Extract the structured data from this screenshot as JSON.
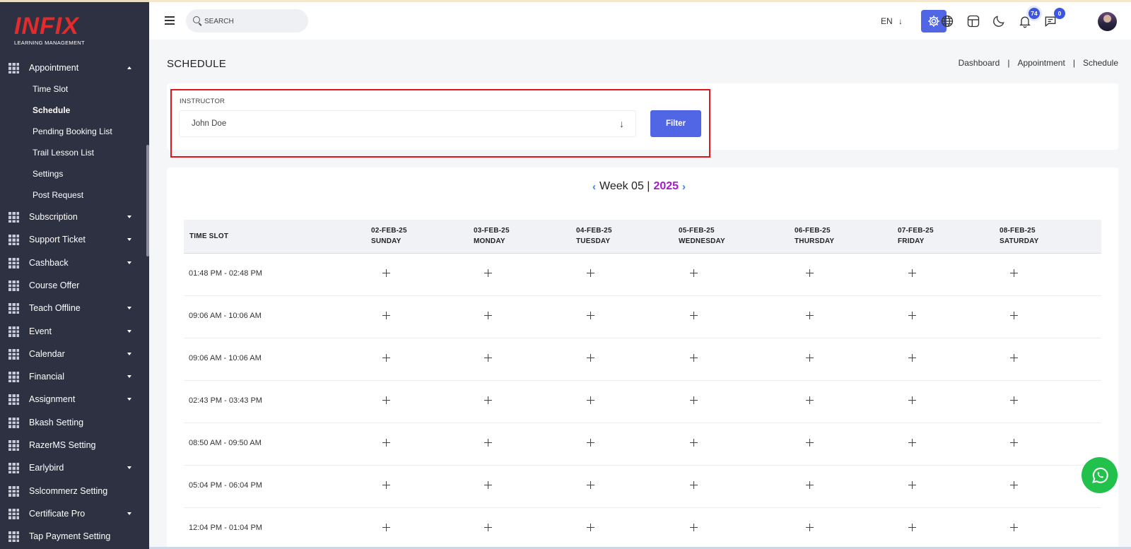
{
  "sidebar": {
    "logo_text": "INFIX",
    "logo_sub": "LEARNING MANAGEMENT",
    "appointment": {
      "label": "Appointment",
      "sub_items": [
        "Time Slot",
        "Schedule",
        "Pending Booking List",
        "Trail Lesson List",
        "Settings",
        "Post Request"
      ],
      "active": "Schedule"
    },
    "items": [
      {
        "label": "Subscription",
        "has_caret": true
      },
      {
        "label": "Support Ticket",
        "has_caret": true
      },
      {
        "label": "Cashback",
        "has_caret": true
      },
      {
        "label": "Course Offer",
        "has_caret": false
      },
      {
        "label": "Teach Offline",
        "has_caret": true
      },
      {
        "label": "Event",
        "has_caret": true
      },
      {
        "label": "Calendar",
        "has_caret": true
      },
      {
        "label": "Financial",
        "has_caret": true
      },
      {
        "label": "Assignment",
        "has_caret": true
      },
      {
        "label": "Bkash Setting",
        "has_caret": false
      },
      {
        "label": "RazerMS Setting",
        "has_caret": false
      },
      {
        "label": "Earlybird",
        "has_caret": true
      },
      {
        "label": "Sslcommerz Setting",
        "has_caret": false
      },
      {
        "label": "Certificate Pro",
        "has_caret": true
      },
      {
        "label": "Tap Payment Setting",
        "has_caret": false
      }
    ]
  },
  "topbar": {
    "search_placeholder": "SEARCH",
    "language": "EN",
    "notifications_count": "74",
    "messages_count": "0",
    "icons": [
      "menu-icon",
      "search-icon",
      "settings-gear-icon",
      "globe-icon",
      "layout-icon",
      "moon-icon",
      "bell-icon",
      "chat-icon"
    ]
  },
  "page": {
    "title": "SCHEDULE",
    "breadcrumb": [
      "Dashboard",
      "Appointment",
      "Schedule"
    ]
  },
  "filter": {
    "label": "INSTRUCTOR",
    "selected": "John Doe",
    "button": "Filter"
  },
  "schedule": {
    "week_label": "Week 05 |",
    "year": "2025",
    "time_slot_header": "TIME SLOT",
    "days": [
      {
        "date": "02-FEB-25",
        "day": "SUNDAY"
      },
      {
        "date": "03-FEB-25",
        "day": "MONDAY"
      },
      {
        "date": "04-FEB-25",
        "day": "TUESDAY"
      },
      {
        "date": "05-FEB-25",
        "day": "WEDNESDAY"
      },
      {
        "date": "06-FEB-25",
        "day": "THURSDAY"
      },
      {
        "date": "07-FEB-25",
        "day": "FRIDAY"
      },
      {
        "date": "08-FEB-25",
        "day": "SATURDAY"
      }
    ],
    "slots": [
      "01:48 PM - 02:48 PM",
      "09:06 AM - 10:06 AM",
      "09:06 AM - 10:06 AM",
      "02:43 PM - 03:43 PM",
      "08:50 AM - 09:50 AM",
      "05:04 PM - 06:04 PM",
      "12:04 PM - 01:04 PM"
    ]
  },
  "colors": {
    "sidebar_bg": "#2d3142",
    "accent": "#5166e5",
    "year": "#a31cc8",
    "highlight": "#e3141e",
    "whatsapp": "#21c14b"
  }
}
